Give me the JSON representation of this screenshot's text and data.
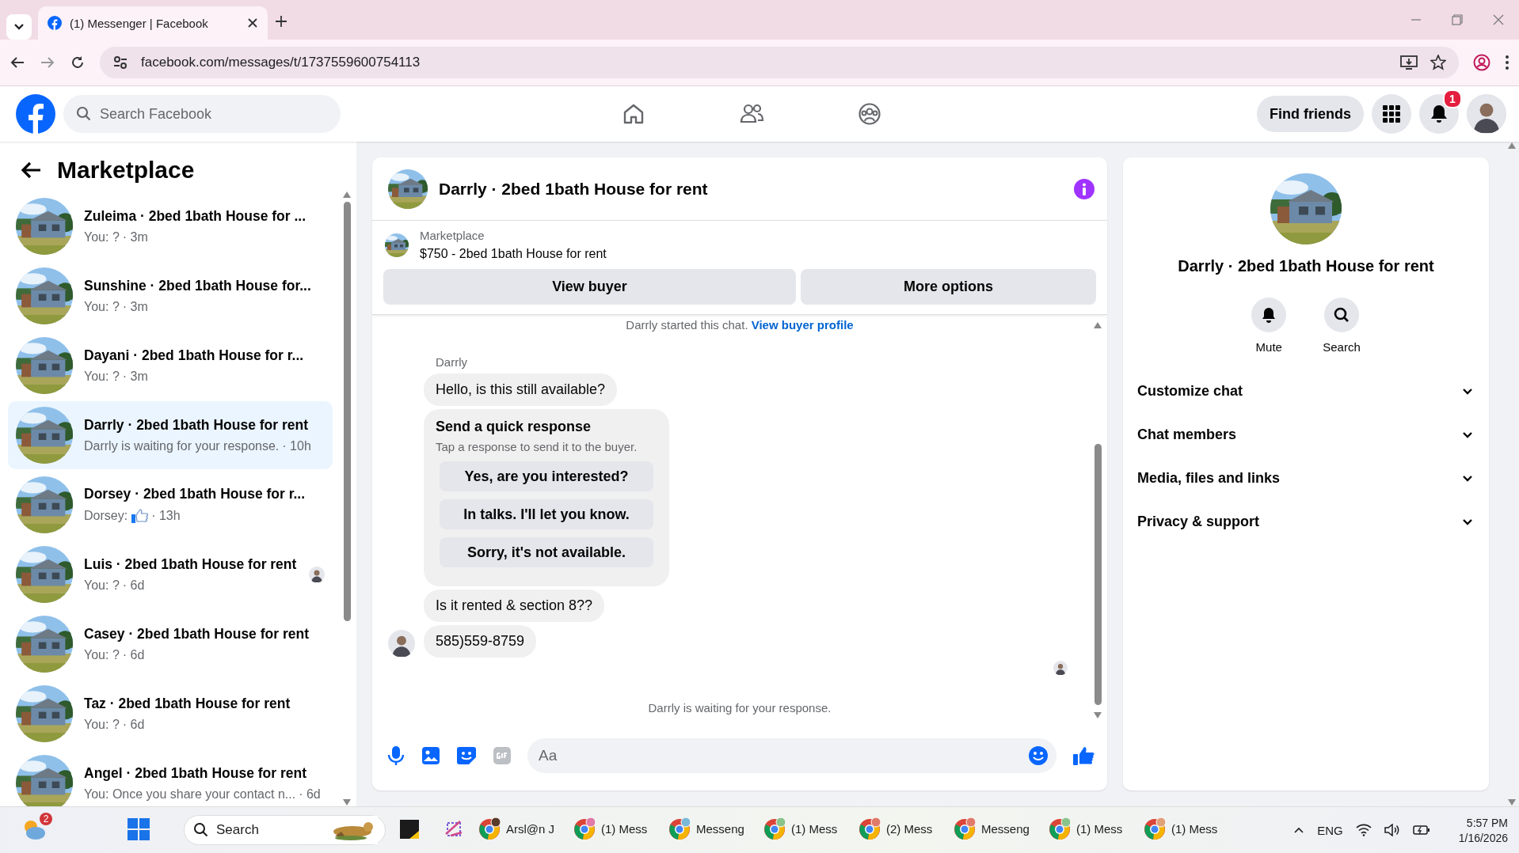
{
  "browser": {
    "tabs": [
      {
        "title": "(1) Messenger | Facebook",
        "selected": true
      }
    ],
    "url": "facebook.com/messages/t/1737559600754113"
  },
  "header": {
    "search": {
      "placeholder": "Search Facebook"
    },
    "find_friends": "Find friends",
    "notification_count": "1"
  },
  "sidebar": {
    "title": "Marketplace",
    "conversations": [
      {
        "title": "Zuleima · 2bed 1bath House for ...",
        "kind": "text",
        "preview": "You: ?",
        "time": "· 3m",
        "selected": false,
        "seen": false
      },
      {
        "title": "Sunshine · 2bed 1bath House for...",
        "kind": "text",
        "preview": "You: ?",
        "time": "· 3m",
        "selected": false,
        "seen": false
      },
      {
        "title": "Dayani · 2bed 1bath House for r...",
        "kind": "text",
        "preview": "You: ?",
        "time": "· 3m",
        "selected": false,
        "seen": false
      },
      {
        "title": "Darrly · 2bed 1bath House for rent",
        "kind": "text",
        "preview": "Darrly is waiting for your response.",
        "time": "· 10h",
        "selected": true,
        "seen": false
      },
      {
        "title": "Dorsey · 2bed 1bath House for r...",
        "kind": "like",
        "preview": "Dorsey:",
        "time": "· 13h",
        "selected": false,
        "seen": false
      },
      {
        "title": "Luis · 2bed 1bath House for rent",
        "kind": "text",
        "preview": "You: ?",
        "time": "· 6d",
        "selected": false,
        "seen": true
      },
      {
        "title": "Casey · 2bed 1bath House for rent",
        "kind": "text",
        "preview": "You: ?",
        "time": "· 6d",
        "selected": false,
        "seen": false
      },
      {
        "title": "Taz · 2bed 1bath House for rent",
        "kind": "text",
        "preview": "You: ?",
        "time": "· 6d",
        "selected": false,
        "seen": false
      },
      {
        "title": "Angel · 2bed 1bath House for rent",
        "kind": "text",
        "preview": "You: Once you share your contact n...",
        "time": "· 6d",
        "selected": false,
        "seen": false
      }
    ]
  },
  "chat": {
    "title": "Darrly · 2bed 1bath House for rent",
    "listing": {
      "label": "Marketplace",
      "description": "$750 - 2bed 1bath House for rent"
    },
    "buttons": [
      "View buyer",
      "More options"
    ],
    "started_note": "Darrly started this chat.",
    "profile_link": "View buyer profile",
    "sender": "Darrly",
    "messages": [
      {
        "kind": "text",
        "text": "Hello, is this still available?"
      },
      {
        "kind": "quick_response",
        "title": "Send a quick response",
        "subtitle": "Tap a response to send it to the buyer.",
        "options": [
          "Yes, are you interested?",
          "In talks. I'll let you know.",
          "Sorry, it's not available."
        ]
      },
      {
        "kind": "text",
        "text": "Is it rented & section 8??"
      },
      {
        "kind": "text",
        "text": "585)559-8759",
        "avatar": true
      }
    ],
    "waiting_note": "Darrly is waiting for your response.",
    "composer": {
      "placeholder": "Aa"
    }
  },
  "details": {
    "title": "Darrly · 2bed 1bath House for rent",
    "actions": [
      {
        "kind": "mute",
        "label": "Mute"
      },
      {
        "kind": "search",
        "label": "Search"
      }
    ],
    "sections": [
      {
        "label": "Customize chat",
        "expanded": false
      },
      {
        "label": "Chat members",
        "expanded": false
      },
      {
        "label": "Media, files and links",
        "expanded": false
      },
      {
        "label": "Privacy & support",
        "expanded": false
      }
    ]
  },
  "taskbar": {
    "weather_badge": "2",
    "search": {
      "placeholder": "Search"
    },
    "apps": [
      {
        "label": "Arsl@n J"
      },
      {
        "label": "(1) Mess"
      },
      {
        "label": "Messeng"
      },
      {
        "label": "(1) Mess"
      },
      {
        "label": "(2) Mess"
      },
      {
        "label": "Messeng"
      },
      {
        "label": "(1) Mess"
      },
      {
        "label": "(1) Mess"
      }
    ],
    "language": "ENG",
    "time": "5:57 PM",
    "date": "1/16/2026"
  }
}
